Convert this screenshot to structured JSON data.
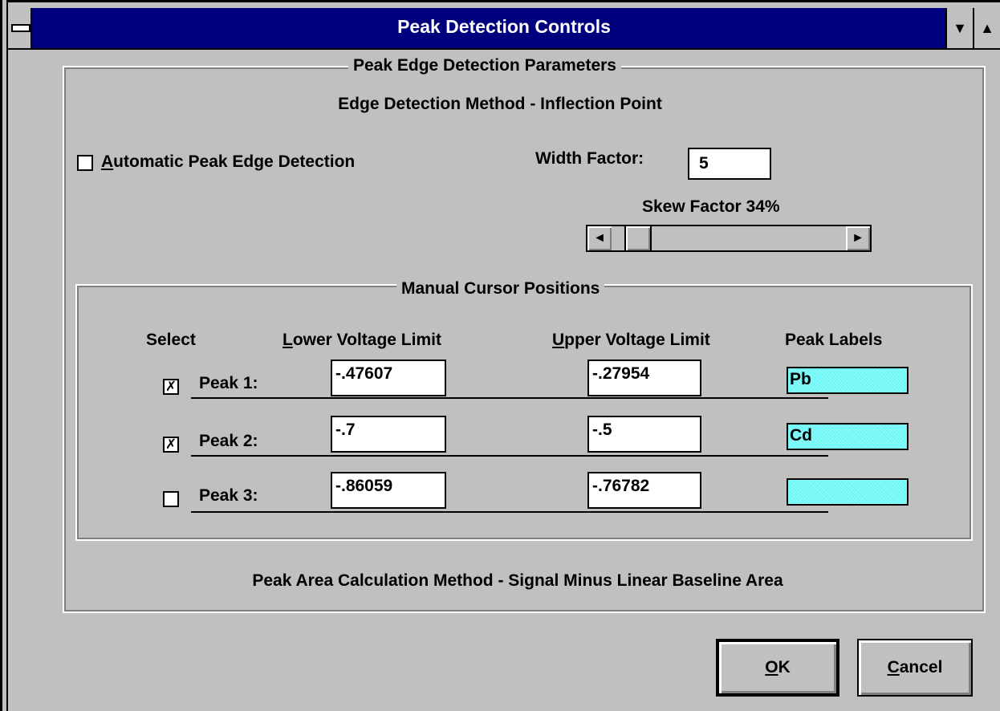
{
  "window": {
    "title": "Peak Detection Controls",
    "minimize_glyph": "▼",
    "maximize_glyph": "▲"
  },
  "edge_group": {
    "legend": "Peak Edge Detection Parameters",
    "method": "Edge Detection Method - Inflection Point",
    "auto_detect": {
      "label_prefix": "",
      "mnemonic": "A",
      "label_rest": "utomatic Peak Edge Detection",
      "checked": false
    },
    "width_factor": {
      "label": "Width Factor:",
      "value": "5"
    },
    "skew": {
      "label": "Skew Factor 34%",
      "percent": 34,
      "left_arrow": "◄",
      "right_arrow": "►"
    }
  },
  "cursor_group": {
    "legend": "Manual Cursor Positions",
    "headers": {
      "select": "Select",
      "lower_mnemonic": "L",
      "lower_rest": "ower Voltage Limit",
      "upper_mnemonic": "U",
      "upper_rest": "pper Voltage Limit",
      "labels": "Peak Labels"
    },
    "peaks": [
      {
        "name": "Peak 1:",
        "checked": true,
        "check_glyph": "✗",
        "lower": "-.47607",
        "upper": "-.27954",
        "label": "Pb"
      },
      {
        "name": "Peak 2:",
        "checked": true,
        "check_glyph": "✗",
        "lower": "-.7",
        "upper": "-.5",
        "label": "Cd"
      },
      {
        "name": "Peak 3:",
        "checked": false,
        "check_glyph": "",
        "lower": "-.86059",
        "upper": "-.76782",
        "label": ""
      }
    ]
  },
  "area_method": "Peak Area Calculation Method - Signal Minus Linear Baseline Area",
  "buttons": {
    "ok_mnemonic": "O",
    "ok_rest": "K",
    "cancel_mnemonic": "C",
    "cancel_rest": "ancel"
  },
  "colors": {
    "titlebar": "#00007e",
    "face": "#c0c0c0",
    "label_field": "#7fffff"
  }
}
